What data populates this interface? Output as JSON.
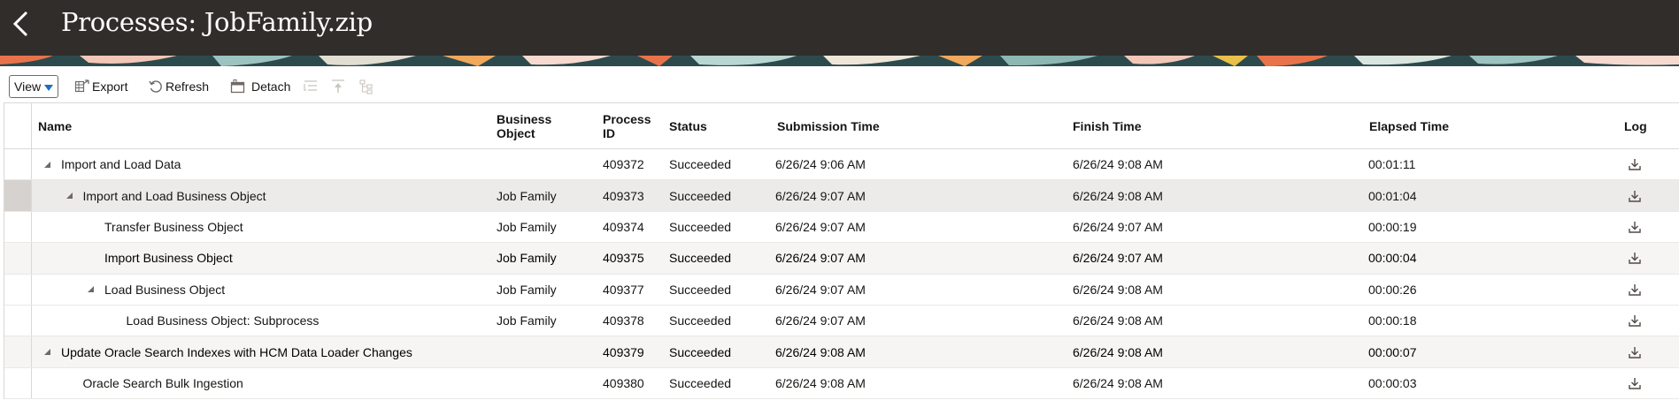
{
  "header": {
    "title": "Processes: JobFamily.zip",
    "background": "#312d2a"
  },
  "toolbar": {
    "view_label": "View",
    "export_label": "Export",
    "refresh_label": "Refresh",
    "detach_label": "Detach"
  },
  "table": {
    "columns": {
      "name": "Name",
      "business_object": "Business Object",
      "process_id": "Process ID",
      "status": "Status",
      "submission_time": "Submission Time",
      "finish_time": "Finish Time",
      "elapsed_time": "Elapsed Time",
      "log": "Log"
    },
    "rows": [
      {
        "name": "Import and Load Data",
        "level": 0,
        "expanded": true,
        "business_object": "",
        "process_id": "409372",
        "status": "Succeeded",
        "submission_time": "6/26/24 9:06 AM",
        "finish_time": "6/26/24 9:08 AM",
        "elapsed_time": "00:01:11"
      },
      {
        "name": "Import and Load Business Object",
        "level": 1,
        "expanded": true,
        "business_object": "Job Family",
        "process_id": "409373",
        "status": "Succeeded",
        "submission_time": "6/26/24 9:07 AM",
        "finish_time": "6/26/24 9:08 AM",
        "elapsed_time": "00:01:04"
      },
      {
        "name": "Transfer Business Object",
        "level": 2,
        "expanded": false,
        "business_object": "Job Family",
        "process_id": "409374",
        "status": "Succeeded",
        "submission_time": "6/26/24 9:07 AM",
        "finish_time": "6/26/24 9:07 AM",
        "elapsed_time": "00:00:19"
      },
      {
        "name": "Import Business Object",
        "level": 2,
        "expanded": false,
        "business_object": "Job Family",
        "process_id": "409375",
        "status": "Succeeded",
        "submission_time": "6/26/24 9:07 AM",
        "finish_time": "6/26/24 9:07 AM",
        "elapsed_time": "00:00:04"
      },
      {
        "name": "Load Business Object",
        "level": 2,
        "expanded": true,
        "business_object": "Job Family",
        "process_id": "409377",
        "status": "Succeeded",
        "submission_time": "6/26/24 9:07 AM",
        "finish_time": "6/26/24 9:08 AM",
        "elapsed_time": "00:00:26"
      },
      {
        "name": "Load Business Object: Subprocess",
        "level": 3,
        "expanded": false,
        "business_object": "Job Family",
        "process_id": "409378",
        "status": "Succeeded",
        "submission_time": "6/26/24 9:07 AM",
        "finish_time": "6/26/24 9:08 AM",
        "elapsed_time": "00:00:18"
      },
      {
        "name": "Update Oracle Search Indexes with HCM Data Loader Changes",
        "level": 0,
        "expanded": true,
        "business_object": "",
        "process_id": "409379",
        "status": "Succeeded",
        "submission_time": "6/26/24 9:08 AM",
        "finish_time": "6/26/24 9:08 AM",
        "elapsed_time": "00:00:07"
      },
      {
        "name": "Oracle Search Bulk Ingestion",
        "level": 1,
        "expanded": false,
        "business_object": "",
        "process_id": "409380",
        "status": "Succeeded",
        "submission_time": "6/26/24 9:08 AM",
        "finish_time": "6/26/24 9:08 AM",
        "elapsed_time": "00:00:03"
      }
    ]
  }
}
